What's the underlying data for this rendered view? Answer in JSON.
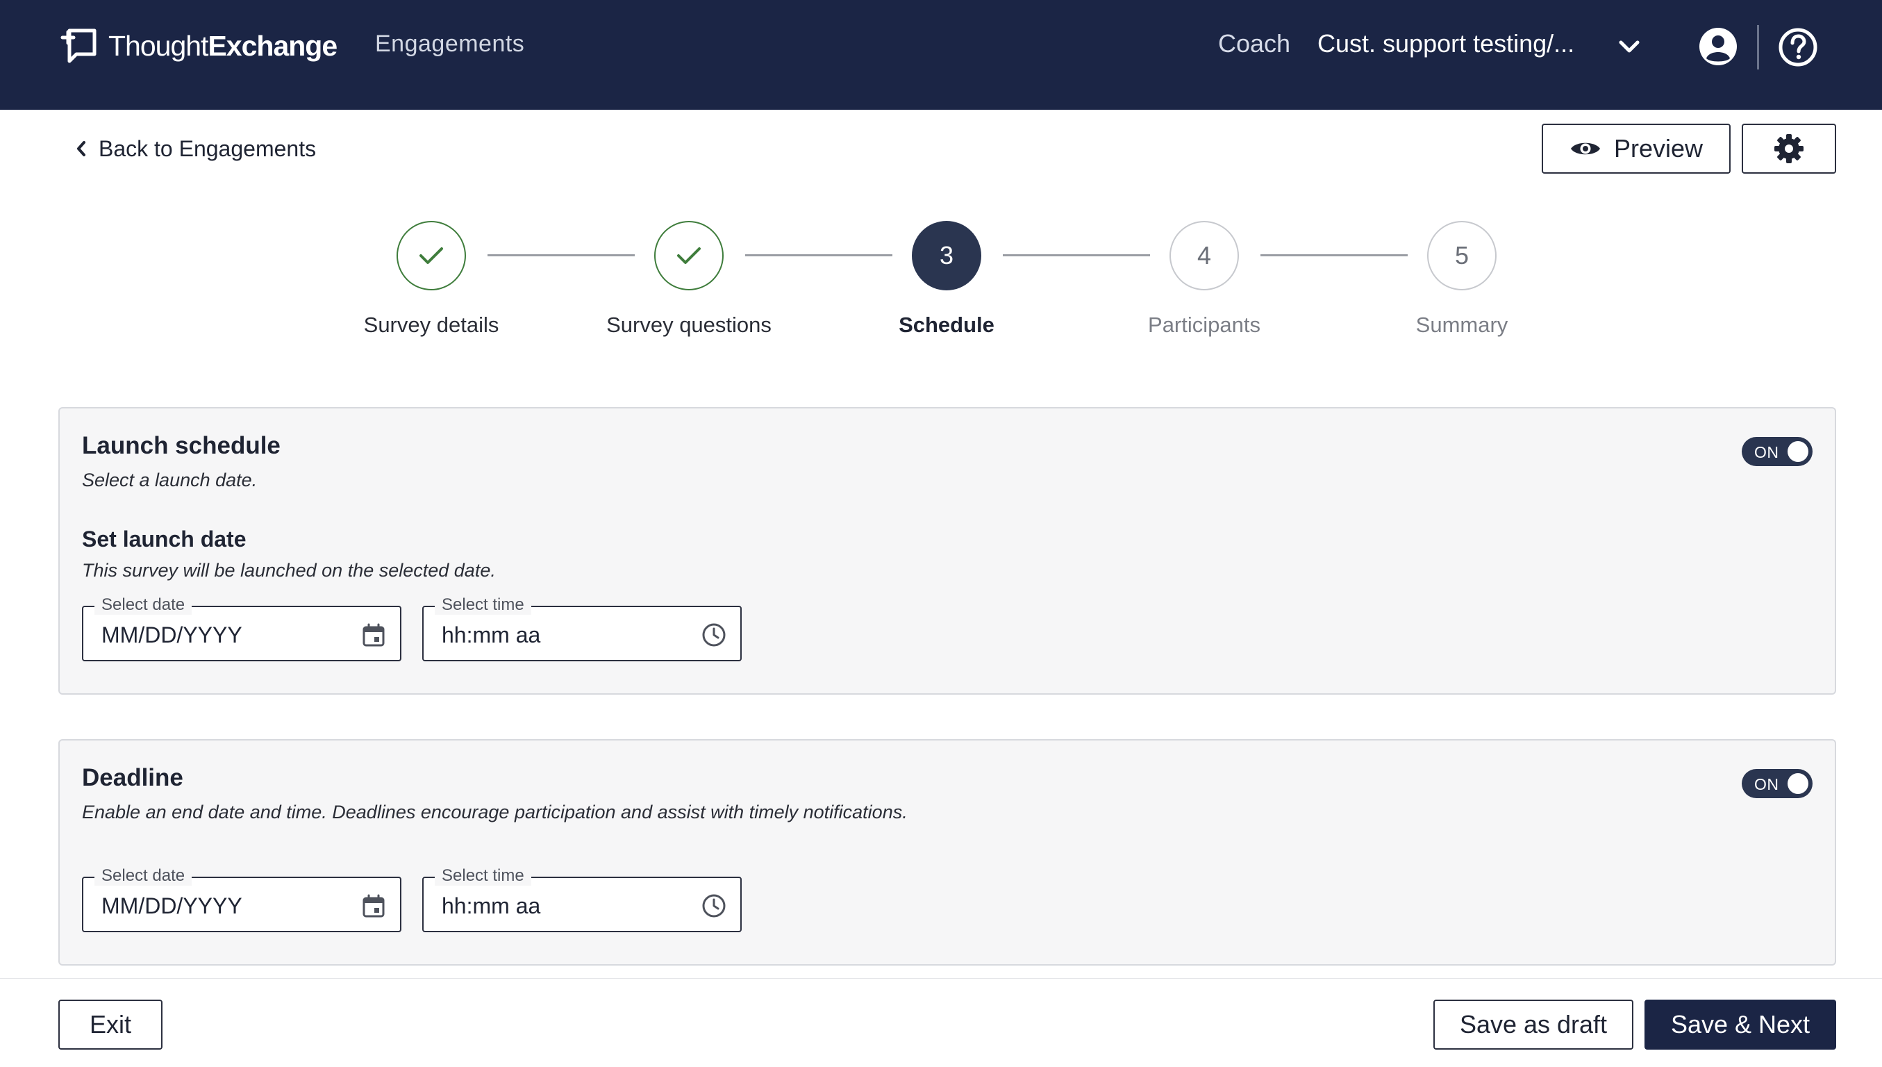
{
  "header": {
    "brand_light": "Thought",
    "brand_bold": "Exchange",
    "nav_link": "Engagements",
    "coach": "Coach",
    "org": "Cust. support testing/..."
  },
  "subheader": {
    "back": "Back to Engagements",
    "preview": "Preview"
  },
  "stepper": {
    "steps": [
      {
        "label": "Survey details",
        "state": "done",
        "number": ""
      },
      {
        "label": "Survey questions",
        "state": "done",
        "number": ""
      },
      {
        "label": "Schedule",
        "state": "current",
        "number": "3"
      },
      {
        "label": "Participants",
        "state": "upcoming",
        "number": "4"
      },
      {
        "label": "Summary",
        "state": "upcoming",
        "number": "5"
      }
    ]
  },
  "launch": {
    "title": "Launch schedule",
    "desc": "Select a launch date.",
    "toggle": "ON",
    "set_title": "Set launch date",
    "set_desc": "This survey will be launched on the selected date.",
    "date_label": "Select date",
    "date_placeholder": "MM/DD/YYYY",
    "time_label": "Select time",
    "time_placeholder": "hh:mm aa"
  },
  "deadline": {
    "title": "Deadline",
    "desc": "Enable an end date and time. Deadlines encourage participation and assist with timely notifications.",
    "toggle": "ON",
    "date_label": "Select date",
    "date_placeholder": "MM/DD/YYYY",
    "time_label": "Select time",
    "time_placeholder": "hh:mm aa"
  },
  "footer": {
    "exit": "Exit",
    "save_draft": "Save as draft",
    "save_next": "Save & Next"
  },
  "colors": {
    "navbar": "#1b2545",
    "accent": "#2a3550",
    "success": "#3f7d3c"
  },
  "icons": [
    "brand-logo-icon",
    "chevron-down-icon",
    "user-avatar-icon",
    "help-icon",
    "chevron-left-icon",
    "eye-icon",
    "gear-icon",
    "check-icon",
    "calendar-icon",
    "clock-icon"
  ]
}
